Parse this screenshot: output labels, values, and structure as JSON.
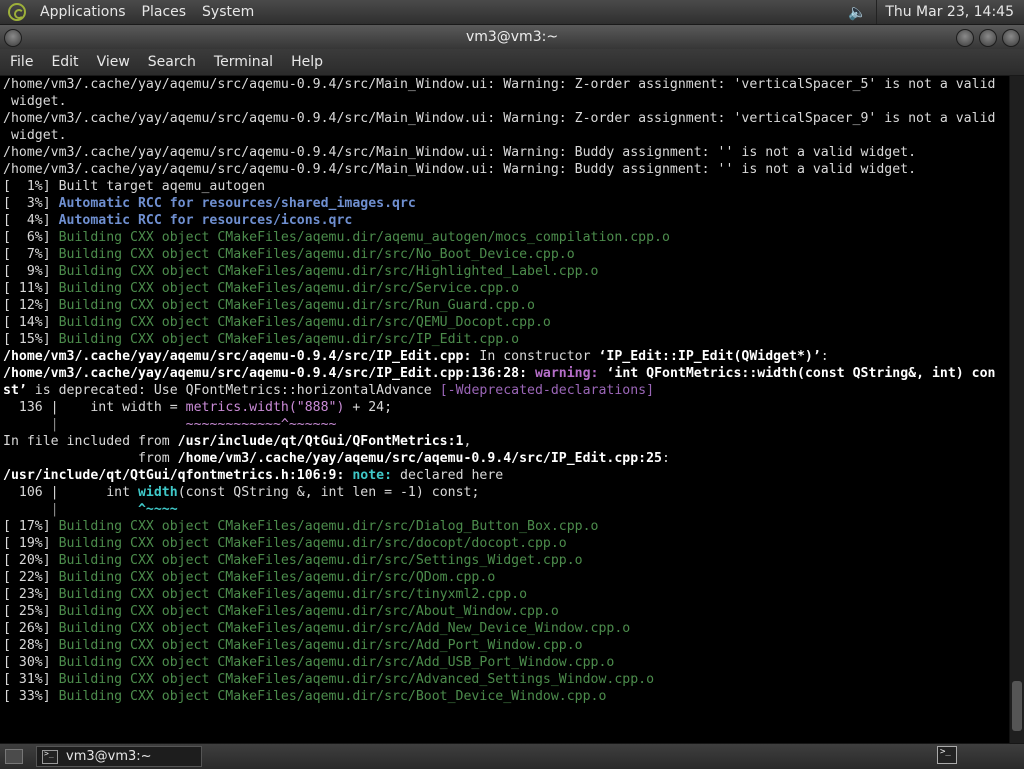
{
  "panel": {
    "menus": [
      "Applications",
      "Places",
      "System"
    ],
    "clock": "Thu Mar 23, 14:45"
  },
  "window": {
    "title": "vm3@vm3:~",
    "menus": [
      "File",
      "Edit",
      "View",
      "Search",
      "Terminal",
      "Help"
    ]
  },
  "terminal": {
    "lines": [
      [
        [
          "w",
          "/home/vm3/.cache/yay/aqemu/src/aqemu-0.9.4/src/Main_Window.ui: Warning: Z-order assignment: 'verticalSpacer_5' is not a valid"
        ]
      ],
      [
        [
          "w",
          " widget."
        ]
      ],
      [
        [
          "w",
          "/home/vm3/.cache/yay/aqemu/src/aqemu-0.9.4/src/Main_Window.ui: Warning: Z-order assignment: 'verticalSpacer_9' is not a valid"
        ]
      ],
      [
        [
          "w",
          " widget."
        ]
      ],
      [
        [
          "w",
          "/home/vm3/.cache/yay/aqemu/src/aqemu-0.9.4/src/Main_Window.ui: Warning: Buddy assignment: '' is not a valid widget."
        ]
      ],
      [
        [
          "w",
          "/home/vm3/.cache/yay/aqemu/src/aqemu-0.9.4/src/Main_Window.ui: Warning: Buddy assignment: '' is not a valid widget."
        ]
      ],
      [
        [
          "w",
          "[  1%] Built target aqemu_autogen"
        ]
      ],
      [
        [
          "w",
          "[  3%] "
        ],
        [
          "b",
          "Automatic RCC for resources/shared_images.qrc"
        ]
      ],
      [
        [
          "w",
          "[  4%] "
        ],
        [
          "b",
          "Automatic RCC for resources/icons.qrc"
        ]
      ],
      [
        [
          "w",
          "[  6%] "
        ],
        [
          "g",
          "Building CXX object CMakeFiles/aqemu.dir/aqemu_autogen/mocs_compilation.cpp.o"
        ]
      ],
      [
        [
          "w",
          "[  7%] "
        ],
        [
          "g",
          "Building CXX object CMakeFiles/aqemu.dir/src/No_Boot_Device.cpp.o"
        ]
      ],
      [
        [
          "w",
          "[  9%] "
        ],
        [
          "g",
          "Building CXX object CMakeFiles/aqemu.dir/src/Highlighted_Label.cpp.o"
        ]
      ],
      [
        [
          "w",
          "[ 11%] "
        ],
        [
          "g",
          "Building CXX object CMakeFiles/aqemu.dir/src/Service.cpp.o"
        ]
      ],
      [
        [
          "w",
          "[ 12%] "
        ],
        [
          "g",
          "Building CXX object CMakeFiles/aqemu.dir/src/Run_Guard.cpp.o"
        ]
      ],
      [
        [
          "w",
          "[ 14%] "
        ],
        [
          "g",
          "Building CXX object CMakeFiles/aqemu.dir/src/QEMU_Docopt.cpp.o"
        ]
      ],
      [
        [
          "w",
          "[ 15%] "
        ],
        [
          "g",
          "Building CXX object CMakeFiles/aqemu.dir/src/IP_Edit.cpp.o"
        ]
      ],
      [
        [
          "wb",
          "/home/vm3/.cache/yay/aqemu/src/aqemu-0.9.4/src/IP_Edit.cpp:"
        ],
        [
          "w",
          " In constructor "
        ],
        [
          "wb",
          "‘IP_Edit::IP_Edit(QWidget*)’"
        ],
        [
          "w",
          ":"
        ]
      ],
      [
        [
          "wb",
          "/home/vm3/.cache/yay/aqemu/src/aqemu-0.9.4/src/IP_Edit.cpp:136:28:"
        ],
        [
          "w",
          " "
        ],
        [
          "mb",
          "warning:"
        ],
        [
          "w",
          " "
        ],
        [
          "wb",
          "‘int QFontMetrics::width(const QString&, int) con"
        ]
      ],
      [
        [
          "wb",
          "st’"
        ],
        [
          "w",
          " is deprecated: Use QFontMetrics::horizontalAdvance "
        ],
        [
          "p",
          "[-Wdeprecated-declarations]"
        ]
      ],
      [
        [
          "w",
          "  136 |    int width = "
        ],
        [
          "m",
          "metrics.width(\"888\")"
        ],
        [
          "w",
          " + 24;"
        ]
      ],
      [
        [
          "d",
          "      |"
        ],
        [
          "w",
          "                "
        ],
        [
          "m",
          "~~~~~~~~~~~~^~~~~~~"
        ]
      ],
      [
        [
          "w",
          "In file included from "
        ],
        [
          "wb",
          "/usr/include/qt/QtGui/QFontMetrics:1"
        ],
        [
          "w",
          ","
        ]
      ],
      [
        [
          "w",
          "                 from "
        ],
        [
          "wb",
          "/home/vm3/.cache/yay/aqemu/src/aqemu-0.9.4/src/IP_Edit.cpp:25"
        ],
        [
          "w",
          ":"
        ]
      ],
      [
        [
          "wb",
          "/usr/include/qt/QtGui/qfontmetrics.h:106:9:"
        ],
        [
          "w",
          " "
        ],
        [
          "cb",
          "note:"
        ],
        [
          "w",
          " declared here"
        ]
      ],
      [
        [
          "w",
          "  106 |      int "
        ],
        [
          "cb",
          "width"
        ],
        [
          "w",
          "(const QString &, int len = -1) const;"
        ]
      ],
      [
        [
          "d",
          "      |"
        ],
        [
          "w",
          "          "
        ],
        [
          "cb",
          "^~~~~"
        ]
      ],
      [
        [
          "w",
          "[ 17%] "
        ],
        [
          "g",
          "Building CXX object CMakeFiles/aqemu.dir/src/Dialog_Button_Box.cpp.o"
        ]
      ],
      [
        [
          "w",
          "[ 19%] "
        ],
        [
          "g",
          "Building CXX object CMakeFiles/aqemu.dir/src/docopt/docopt.cpp.o"
        ]
      ],
      [
        [
          "w",
          "[ 20%] "
        ],
        [
          "g",
          "Building CXX object CMakeFiles/aqemu.dir/src/Settings_Widget.cpp.o"
        ]
      ],
      [
        [
          "w",
          "[ 22%] "
        ],
        [
          "g",
          "Building CXX object CMakeFiles/aqemu.dir/src/QDom.cpp.o"
        ]
      ],
      [
        [
          "w",
          "[ 23%] "
        ],
        [
          "g",
          "Building CXX object CMakeFiles/aqemu.dir/src/tinyxml2.cpp.o"
        ]
      ],
      [
        [
          "w",
          "[ 25%] "
        ],
        [
          "g",
          "Building CXX object CMakeFiles/aqemu.dir/src/About_Window.cpp.o"
        ]
      ],
      [
        [
          "w",
          "[ 26%] "
        ],
        [
          "g",
          "Building CXX object CMakeFiles/aqemu.dir/src/Add_New_Device_Window.cpp.o"
        ]
      ],
      [
        [
          "w",
          "[ 28%] "
        ],
        [
          "g",
          "Building CXX object CMakeFiles/aqemu.dir/src/Add_Port_Window.cpp.o"
        ]
      ],
      [
        [
          "w",
          "[ 30%] "
        ],
        [
          "g",
          "Building CXX object CMakeFiles/aqemu.dir/src/Add_USB_Port_Window.cpp.o"
        ]
      ],
      [
        [
          "w",
          "[ 31%] "
        ],
        [
          "g",
          "Building CXX object CMakeFiles/aqemu.dir/src/Advanced_Settings_Window.cpp.o"
        ]
      ],
      [
        [
          "w",
          "[ 33%] "
        ],
        [
          "g",
          "Building CXX object CMakeFiles/aqemu.dir/src/Boot_Device_Window.cpp.o"
        ]
      ]
    ]
  },
  "taskbar": {
    "task_label": "vm3@vm3:~"
  }
}
